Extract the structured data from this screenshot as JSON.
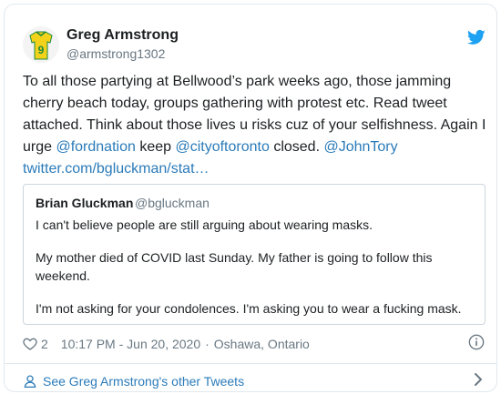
{
  "author": {
    "name": "Greg Armstrong",
    "handle": "@armstrong1302",
    "jersey_number": "9"
  },
  "tweet": {
    "text_1": "To all those partying at Bellwood’s park weeks ago, those jamming cherry beach today, groups gathering with protest etc. Read tweet attached. Think about those lives u risks cuz of your selfishness. Again I urge ",
    "mention_1": "@fordnation",
    "text_2": " keep ",
    "mention_2": "@cityoftoronto",
    "text_3": " closed. ",
    "mention_3": "@JohnTory",
    "link": "twitter.com/bgluckman/stat…"
  },
  "quoted": {
    "name": "Brian Gluckman",
    "handle": "@bgluckman",
    "line1": "I can't believe people are still arguing about wearing masks.",
    "line2": "My mother died of COVID last Sunday. My father is going to follow this",
    "line3": "weekend.",
    "line4": "I'm not asking for your condolences. I'm asking you to wear a fucking mask."
  },
  "meta": {
    "likes": "2",
    "timestamp": "10:17 PM - Jun 20, 2020",
    "separator": "·",
    "location": "Oshawa, Ontario"
  },
  "footer": {
    "see_more": "See Greg Armstrong's other Tweets"
  },
  "colors": {
    "link": "#2b7bb9",
    "twitter_blue": "#1da1f2",
    "jersey_yellow": "#f2d21b",
    "jersey_green": "#1d8a3c"
  }
}
